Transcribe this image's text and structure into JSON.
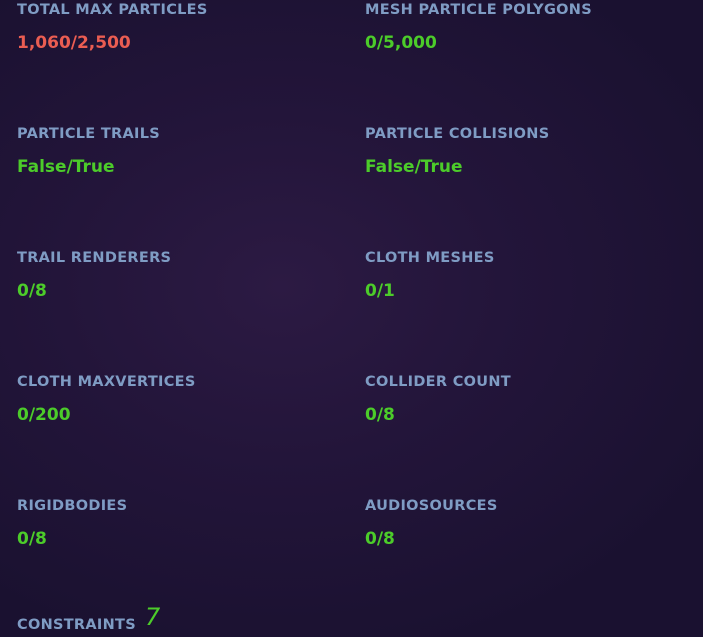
{
  "stats": [
    {
      "label": "TOTAL MAX PARTICLES",
      "value": "1,060/2,500",
      "status": "warn"
    },
    {
      "label": "MESH PARTICLE POLYGONS",
      "value": "0/5,000",
      "status": "ok"
    },
    {
      "label": "PARTICLE TRAILS",
      "value": "False/True",
      "status": "ok"
    },
    {
      "label": "PARTICLE COLLISIONS",
      "value": "False/True",
      "status": "ok"
    },
    {
      "label": "TRAIL RENDERERS",
      "value": "0/8",
      "status": "ok"
    },
    {
      "label": "CLOTH MESHES",
      "value": "0/1",
      "status": "ok"
    },
    {
      "label": "CLOTH MAXVERTICES",
      "value": "0/200",
      "status": "ok"
    },
    {
      "label": "COLLIDER COUNT",
      "value": "0/8",
      "status": "ok"
    },
    {
      "label": "RIGIDBODIES",
      "value": "0/8",
      "status": "ok"
    },
    {
      "label": "AUDIOSOURCES",
      "value": "0/8",
      "status": "ok"
    }
  ],
  "constraints": {
    "label": "CONSTRAINTS",
    "value": "7"
  },
  "colors": {
    "label": "#7f9cc4",
    "ok": "#4ccc2a",
    "warn": "#ea5d52",
    "background": "#23153a"
  }
}
